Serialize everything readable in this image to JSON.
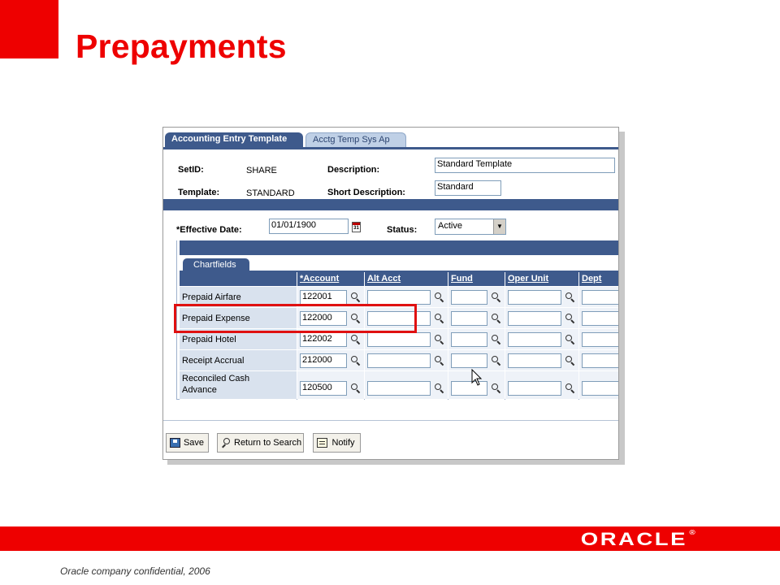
{
  "slide": {
    "title": "Prepayments",
    "footer_text": "Oracle company confidential, 2006",
    "logo_text": "ORACLE",
    "logo_mark": "®",
    "colors": {
      "brand_red": "#ee0000",
      "header_blue": "#3e5a8c"
    }
  },
  "window": {
    "tabs": [
      {
        "label": "Accounting Entry Template",
        "active": true
      },
      {
        "label": "Acctg Temp Sys Ap",
        "active": false
      }
    ],
    "header": {
      "setid_label": "SetID:",
      "setid_value": "SHARE",
      "template_label": "Template:",
      "template_value": "STANDARD",
      "description_label": "Description:",
      "description_value": "Standard Template",
      "short_description_label": "Short Description:",
      "short_description_value": "Standard"
    },
    "effective_date": {
      "label": "*Effective Date:",
      "value": "01/01/1900",
      "calendar_icon_text": "31"
    },
    "status": {
      "label": "Status:",
      "value": "Active"
    },
    "grid": {
      "subtab": "Chartfields",
      "columns": [
        "*Account",
        "Alt Acct",
        "Fund",
        "Oper Unit",
        "Dept"
      ],
      "rows": [
        {
          "label": "Prepaid Airfare",
          "account": "122001"
        },
        {
          "label": "Prepaid Expense",
          "account": "122000"
        },
        {
          "label": "Prepaid Hotel",
          "account": "122002"
        },
        {
          "label": "Receipt Accrual",
          "account": "212000"
        },
        {
          "label_line1": "Reconciled Cash",
          "label_line2": "Advance",
          "account": "120500"
        }
      ]
    },
    "buttons": {
      "save": "Save",
      "return": "Return to Search",
      "notify": "Notify"
    }
  }
}
